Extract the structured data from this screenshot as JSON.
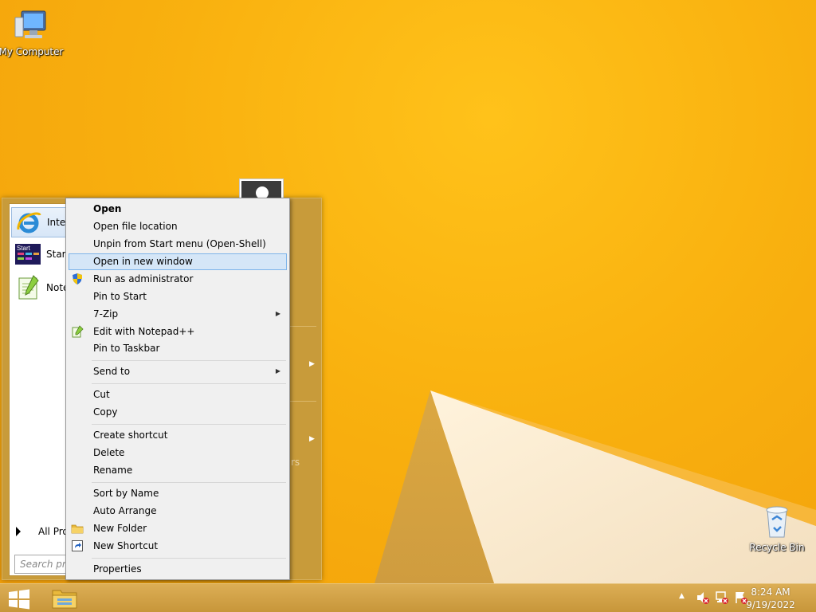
{
  "desktop": {
    "icons": [
      {
        "label": "My Computer",
        "icon": "computer-icon"
      },
      {
        "label": "Recycle Bin",
        "icon": "recycle-bin-icon"
      }
    ]
  },
  "start_menu": {
    "programs": [
      {
        "label": "Intern",
        "icon": "internet-explorer-icon"
      },
      {
        "label": "Start S",
        "icon": "start-screen-icon"
      },
      {
        "label": "Notep",
        "icon": "notepad-plus-plus-icon"
      }
    ],
    "start_screen_icon_text": "Start",
    "all_programs_label": "All Pro",
    "search_placeholder": "Search prog",
    "partial_text": "rs",
    "accent": "#c89b3a"
  },
  "context_menu": {
    "items": [
      {
        "label": "Open",
        "bold": true
      },
      {
        "label": "Open file location"
      },
      {
        "label": "Unpin from Start menu (Open-Shell)"
      },
      {
        "label": "Open in new window",
        "highlighted": true
      },
      {
        "label": "Run as administrator",
        "icon": "uac-shield-icon"
      },
      {
        "label": "Pin to Start"
      },
      {
        "label": "7-Zip",
        "submenu": true
      },
      {
        "label": "Edit with Notepad++",
        "icon": "notepad-plus-plus-icon"
      },
      {
        "label": "Pin to Taskbar"
      },
      {
        "label": "Send to",
        "submenu": true
      },
      {
        "label": "Cut"
      },
      {
        "label": "Copy"
      },
      {
        "label": "Create shortcut"
      },
      {
        "label": "Delete"
      },
      {
        "label": "Rename"
      },
      {
        "label": "Sort by Name"
      },
      {
        "label": "Auto Arrange"
      },
      {
        "label": "New Folder",
        "icon": "folder-icon"
      },
      {
        "label": "New Shortcut",
        "icon": "shortcut-icon"
      },
      {
        "label": "Properties"
      }
    ],
    "highlight_color": "#d5e6f7"
  },
  "taskbar": {
    "time": "8:24 AM",
    "date": "9/19/2022",
    "tray_icons": [
      "speaker-muted-icon",
      "network-error-icon",
      "action-center-flag-icon"
    ]
  }
}
